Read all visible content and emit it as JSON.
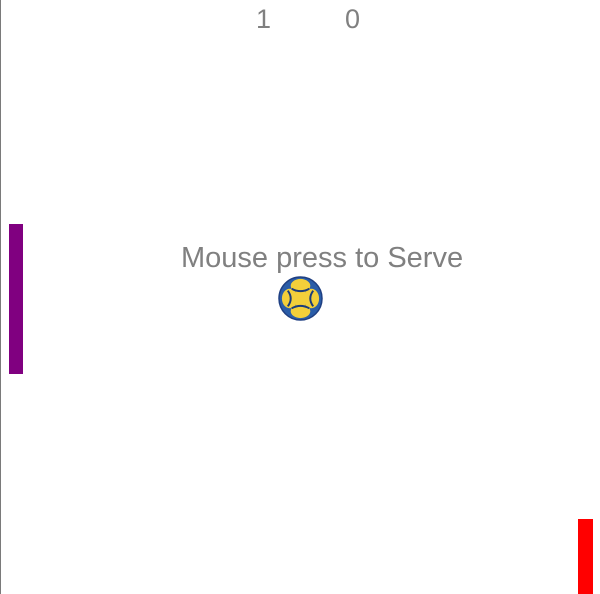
{
  "score": {
    "left": "1",
    "right": "0"
  },
  "message": "Mouse press to Serve",
  "paddles": {
    "left_color": "#800080",
    "right_color": "#ff0000"
  },
  "ball": {
    "icon": "soccer-ball-icon",
    "primary_color": "#2a5da8",
    "secondary_color": "#f2cf3a"
  },
  "colors": {
    "background": "#ffffff",
    "text": "#808080"
  }
}
